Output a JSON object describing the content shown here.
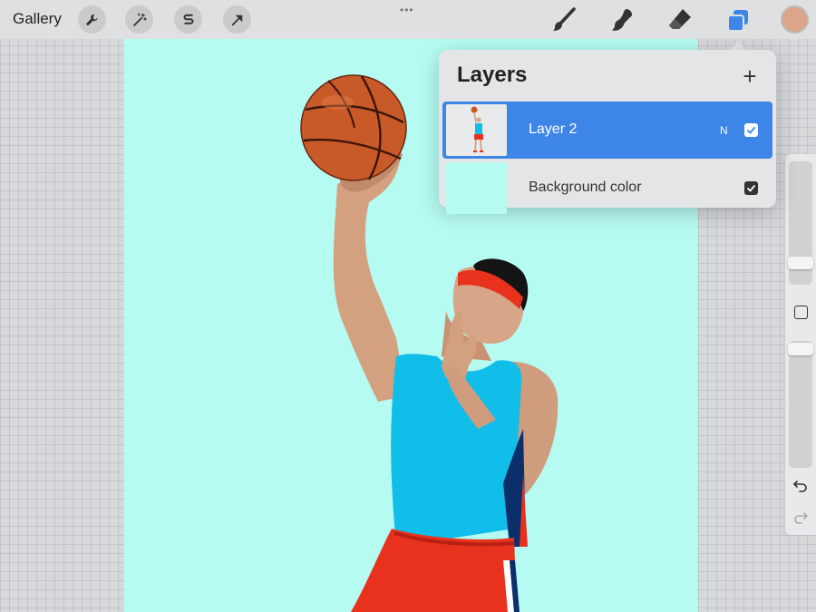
{
  "toolbar": {
    "gallery_label": "Gallery",
    "left_tools": [
      {
        "name": "wrench-icon"
      },
      {
        "name": "magic-wand-icon"
      },
      {
        "name": "selection-s-icon"
      },
      {
        "name": "transform-arrow-icon"
      }
    ],
    "right_tools": [
      {
        "name": "brush-icon"
      },
      {
        "name": "smudge-icon"
      },
      {
        "name": "eraser-icon"
      },
      {
        "name": "layers-icon",
        "active": true
      }
    ],
    "current_color": "#dca489"
  },
  "canvas": {
    "background_color": "#b6fbf2"
  },
  "layers_panel": {
    "title": "Layers",
    "add_symbol": "+",
    "layers": [
      {
        "name": "Layer 2",
        "blend_mode": "N",
        "visible": true,
        "selected": true
      },
      {
        "name": "Background color",
        "visible": true,
        "selected": false
      }
    ]
  },
  "sidebar": {
    "tools": [
      {
        "name": "brush-size-slider",
        "level": 0.3
      },
      {
        "name": "modifier-button"
      },
      {
        "name": "opacity-slider",
        "level": 0.05
      },
      {
        "name": "undo-icon"
      },
      {
        "name": "redo-icon"
      }
    ]
  },
  "accent_color": "#3d86e8"
}
